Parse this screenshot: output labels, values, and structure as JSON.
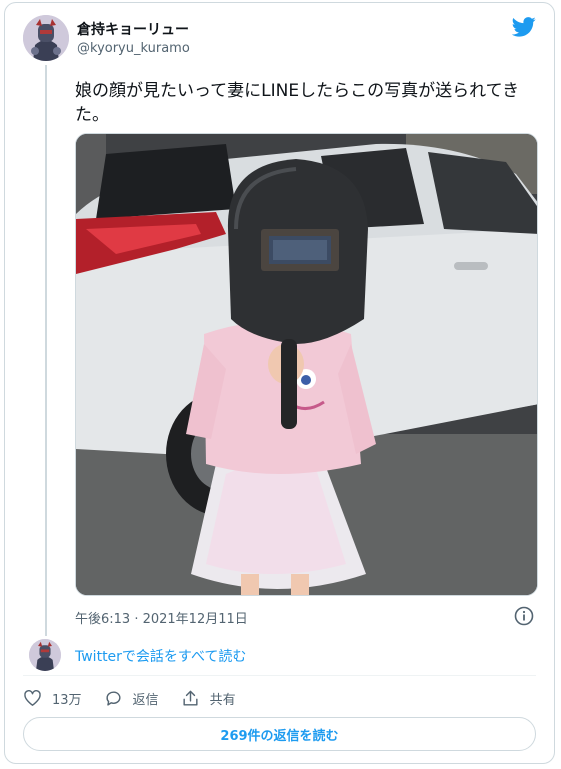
{
  "author": {
    "name": "倉持キョーリュー",
    "handle": "@kyoryu_kuramo"
  },
  "tweet": {
    "text": "娘の顔が見たいって妻にLINEしたらこの写真が送られてきた。",
    "timestamp": "午後6:13 · 2021年12月11日"
  },
  "conversation": {
    "read_label": "Twitterで会話をすべて読む"
  },
  "actions": {
    "like_count": "13万",
    "reply_label": "返信",
    "share_label": "共有"
  },
  "replies_button": {
    "label": "269件の返信を読む"
  },
  "colors": {
    "accent": "#1d9bf0",
    "secondary_text": "#536471",
    "border": "#cfd9de"
  },
  "icons": [
    "twitter-bird-icon",
    "info-icon",
    "heart-icon",
    "reply-icon",
    "share-icon"
  ]
}
